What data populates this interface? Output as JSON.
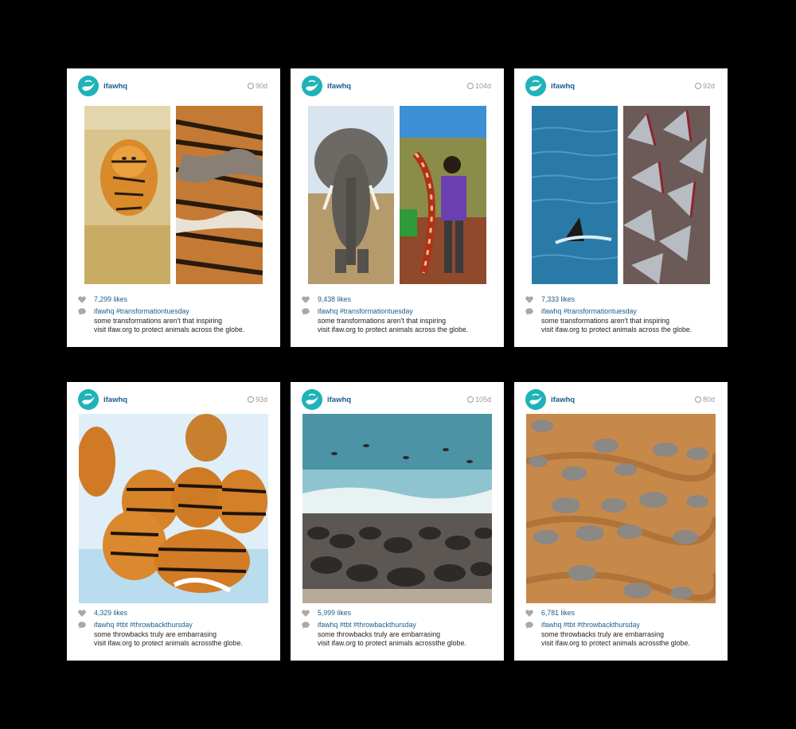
{
  "posts": [
    {
      "user": "ifawhq",
      "age": "90d",
      "likes": "7,299 likes",
      "tags": "#transformationtuesday",
      "line1": "some transformations aren't that inspiring",
      "line2": "visit ifaw.org to protect animals across the globe.",
      "images": [
        "tiger-in-grass-photo",
        "tiger-pelts-photo"
      ]
    },
    {
      "user": "ifawhq",
      "age": "104d",
      "likes": "9,438 likes",
      "tags": "#transformationtuesday",
      "line1": "some transformations aren't that inspiring",
      "line2": "visit ifaw.org to protect animals across the globe.",
      "images": [
        "elephant-photo",
        "ivory-tusk-photo"
      ]
    },
    {
      "user": "ifawhq",
      "age": "92d",
      "likes": "7,333 likes",
      "tags": "#transformationtuesday",
      "line1": "some transformations aren't that inspiring",
      "line2": "visit ifaw.org to protect animals across the globe.",
      "images": [
        "shark-fin-ocean-photo",
        "shark-fins-pile-photo"
      ]
    },
    {
      "user": "ifawhq",
      "age": "93d",
      "likes": "4,329 likes",
      "tags": "#tbt #throwbackthursday",
      "line1": "some throwbacks truly are embarrasing",
      "line2": "visit ifaw.org to protect animals acrossthe globe.",
      "images": [
        "tigers-in-snow-photo"
      ]
    },
    {
      "user": "ifawhq",
      "age": "105d",
      "likes": "5,999 likes",
      "tags": "#tbt #throwbackthursday",
      "line1": "some throwbacks truly are embarrasing",
      "line2": "visit ifaw.org to protect animals acrossthe globe.",
      "images": [
        "seal-colony-photo"
      ]
    },
    {
      "user": "ifawhq",
      "age": "80d",
      "likes": "6,781 likes",
      "tags": "#tbt #throwbackthursday",
      "line1": "some throwbacks truly are embarrasing",
      "line2": "visit ifaw.org to protect animals acrossthe globe.",
      "images": [
        "elephant-herd-aerial-photo"
      ]
    }
  ],
  "colors": {
    "brand": "#1fb3b8",
    "link": "#1c5c8c",
    "muted": "#9a9a9a",
    "background": "#000000"
  }
}
